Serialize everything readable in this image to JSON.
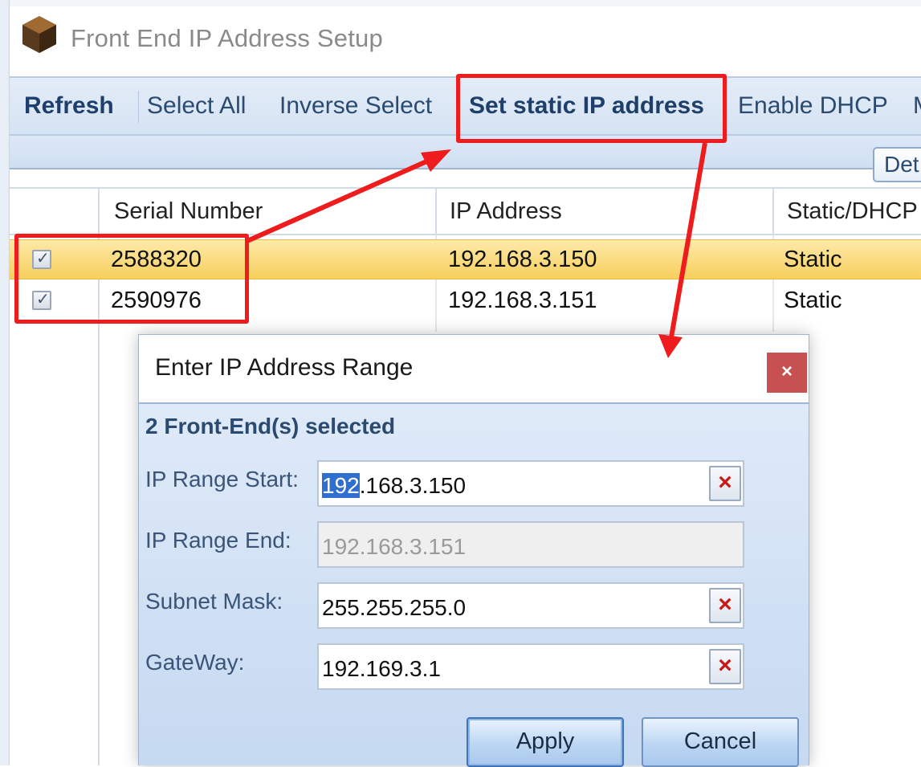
{
  "window": {
    "title": "Front End IP Address Setup",
    "icon": "cube-icon"
  },
  "toolbar": {
    "items": [
      {
        "label": "Refresh",
        "bold": true
      },
      {
        "label": "Select All",
        "bold": false
      },
      {
        "label": "Inverse Select",
        "bold": false
      },
      {
        "label": "Set static IP address",
        "bold": true
      },
      {
        "label": "Enable DHCP",
        "bold": false
      },
      {
        "label": "M",
        "bold": false
      }
    ],
    "sub_button": "Det"
  },
  "grid": {
    "columns": [
      "Serial Number",
      "IP Address",
      "Static/DHCP"
    ],
    "rows": [
      {
        "checked": true,
        "serial": "2588320",
        "ip": "192.168.3.150",
        "mode": "Static",
        "selected": true
      },
      {
        "checked": true,
        "serial": "2590976",
        "ip": "192.168.3.151",
        "mode": "Static",
        "selected": false
      }
    ]
  },
  "dialog": {
    "title": "Enter IP Address Range",
    "close_label": "×",
    "selected_count": "2 Front-End(s) selected",
    "fields": {
      "start": {
        "label": "IP Range Start:",
        "value_selected": "192",
        "value_rest": ".168.3.150"
      },
      "end": {
        "label": "IP Range End:",
        "value": "192.168.3.151"
      },
      "mask": {
        "label": "Subnet Mask:",
        "value": "255.255.255.0"
      },
      "gateway": {
        "label": "GateWay:",
        "value": "192.169.3.1"
      }
    },
    "clear_glyph": "×",
    "apply_label": "Apply",
    "cancel_label": "Cancel"
  },
  "colors": {
    "annotation": "#ee1c1c",
    "selected_row": "#f7cf5d",
    "close_button": "#c75050",
    "text_selection": "#2f6fd0"
  }
}
